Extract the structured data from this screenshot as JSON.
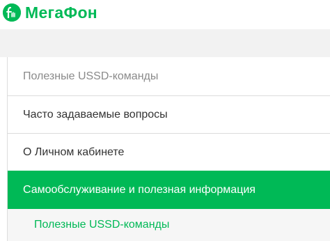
{
  "header": {
    "brand_name": "МегаФон",
    "brand_color": "#00b956",
    "logo_icon": "megafon-logo-icon"
  },
  "menu": {
    "items": [
      {
        "label": "Полезные USSD-команды",
        "state": "dim"
      },
      {
        "label": "Часто задаваемые вопросы",
        "state": "normal"
      },
      {
        "label": "О Личном кабинете",
        "state": "normal"
      },
      {
        "label": "Самообслуживание и полезная информация",
        "state": "active"
      }
    ],
    "submenu": {
      "items": [
        {
          "label": "Полезные USSD-команды"
        }
      ]
    }
  }
}
